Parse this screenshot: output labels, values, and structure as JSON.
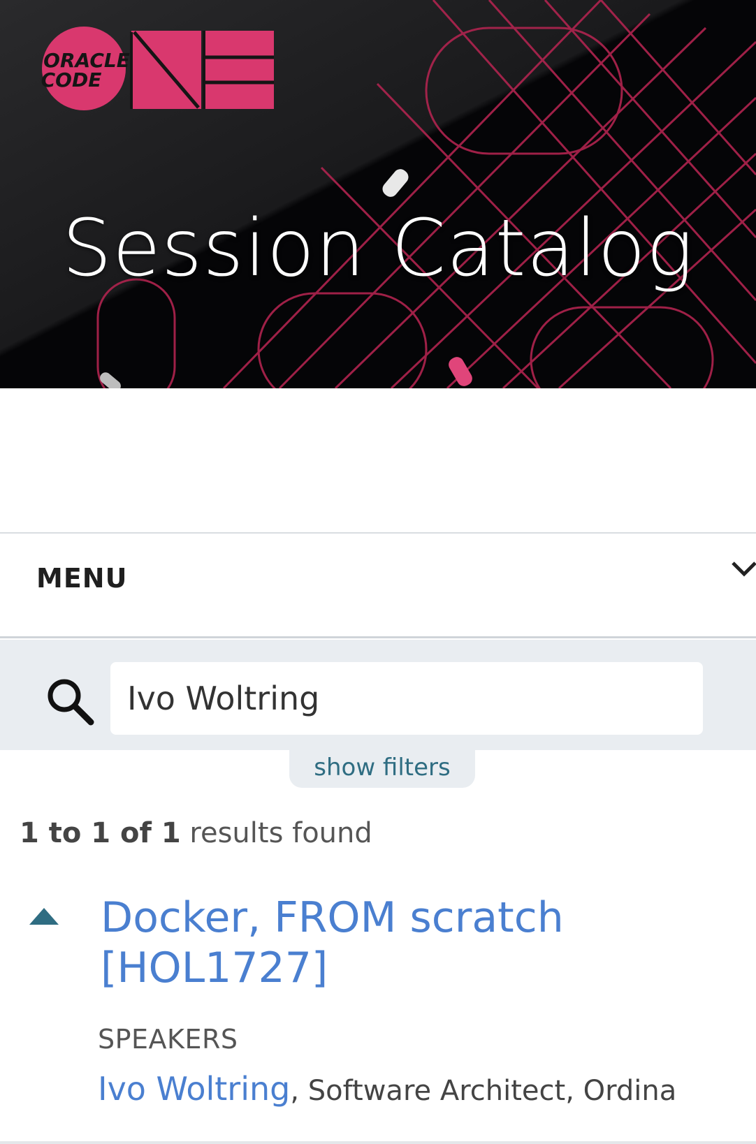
{
  "hero": {
    "logo_text_line1": "ORACLE",
    "logo_text_line2": "CODE",
    "title": "Session Catalog",
    "accent_color": "#d9386e"
  },
  "menu": {
    "label": "MENU",
    "icon": "chevron-down-icon"
  },
  "search": {
    "icon": "search-icon",
    "value": "Ivo Woltring",
    "filters_label": "show filters"
  },
  "results": {
    "count_bold": "1 to 1 of 1",
    "count_text": " results found",
    "items": [
      {
        "toggle_icon": "triangle-up-icon",
        "title": "Docker, FROM scratch [HOL1727]",
        "speakers_heading": "SPEAKERS",
        "speaker_name": "Ivo Woltring",
        "speaker_role": ", Software Architect, Ordina"
      }
    ]
  },
  "colors": {
    "link": "#4a7fd0",
    "teal": "#2f6d82",
    "search_band": "#e9edf1"
  }
}
